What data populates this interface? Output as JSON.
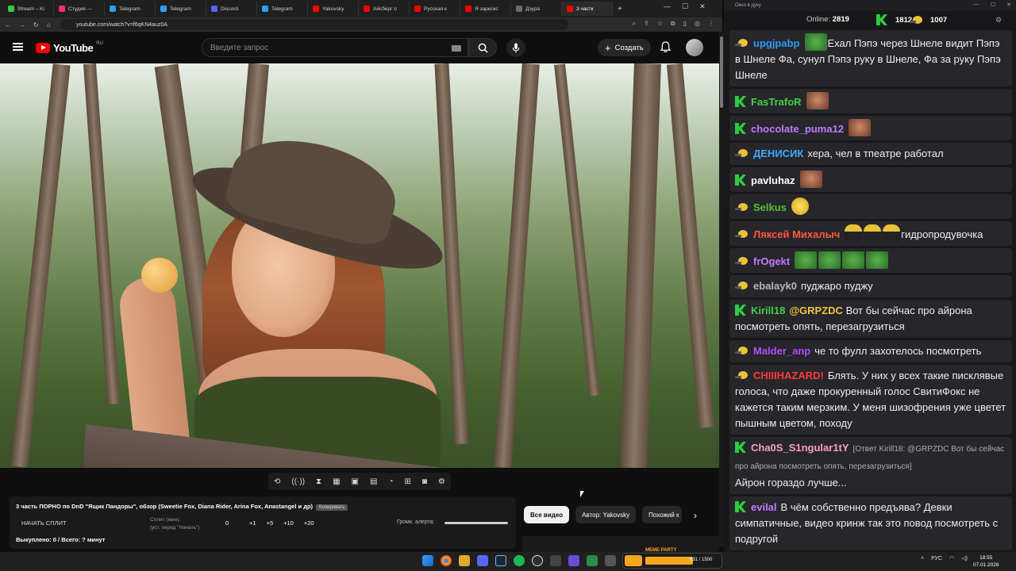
{
  "browser": {
    "tabs": [
      {
        "label": "Stream – Ki",
        "color": "#2ecc40"
      },
      {
        "label": "Студия —",
        "color": "#ff2e63"
      },
      {
        "label": "Telegram",
        "color": "#2aa3ef"
      },
      {
        "label": "Telegram",
        "color": "#2aa3ef"
      },
      {
        "label": "Discord",
        "color": "#5865f2"
      },
      {
        "label": "Telegram",
        "color": "#2aa3ef"
      },
      {
        "label": "Yakovsky",
        "color": "#ff0000"
      },
      {
        "label": "Айсберг о",
        "color": "#ff0000"
      },
      {
        "label": "Русская к",
        "color": "#ff0000"
      },
      {
        "label": "Я зарегис",
        "color": "#ff0000"
      },
      {
        "label": "Дзура",
        "color": "#6b6b6b"
      },
      {
        "label": "3 частк",
        "color": "#ff0000",
        "active": true
      }
    ],
    "new_tab": "+",
    "url": "youtube.com/watch?v=f6qKN4auz0A"
  },
  "youtube": {
    "logo_text": "YouTube",
    "region": "RU",
    "search_placeholder": "Введите запрос",
    "create_label": "Создать"
  },
  "split_panel": {
    "title": "3 часть ПОРНО по DnD \"Ящик Пандоры\", обзор (Sweetie Fox, Diana Rider, Arina Fox, Anastangel и др)",
    "copy_label": "Копировать",
    "start_label": "НАЧАТЬ СПЛИТ",
    "split_label": "Сплит (мин):",
    "split_hint": "(уст. перед \"Начать\")",
    "split_value": "0",
    "increments": [
      "+1",
      "+5",
      "+10",
      "+20"
    ],
    "volume_label": "Громк. алерта:",
    "bought": "Выкуплено: 0 / Всего: ? минут"
  },
  "chips": [
    {
      "label": "Все видео",
      "selected": true
    },
    {
      "label": "Автор: Yakovsky",
      "selected": false
    },
    {
      "label": "Похожий к",
      "selected": false
    }
  ],
  "chat": {
    "window_title": "Окно в дуку",
    "online_label": "Online:",
    "online_count": "2819",
    "k_count": "1812",
    "g_count": "1007",
    "messages": [
      {
        "badge": "g",
        "user": "upgjpabp",
        "color": "#2f9cf4",
        "emotes": [
          "pepe"
        ],
        "text": "Ехал Пэпэ через Шнеле видит Пэпэ в Шнеле Фа, сунул Пэпэ руку в Шнеле, Фа за руку Пэпэ Шнеле"
      },
      {
        "badge": "k",
        "user": "FasTrafoR",
        "color": "#45d04a",
        "emotes": [
          "face"
        ],
        "text": ""
      },
      {
        "badge": "k",
        "user": "chocolate_puma12",
        "color": "#c27bff",
        "emotes": [
          "face"
        ],
        "text": ""
      },
      {
        "badge": "g",
        "user": "ДЕНИСИК",
        "color": "#3fa9ff",
        "emotes": [],
        "text": "хера, чел в тпеатре работал"
      },
      {
        "badge": "k",
        "user": "pavluhaz",
        "color": "#ffffff",
        "emotes": [
          "face"
        ],
        "text": ""
      },
      {
        "badge": "g",
        "user": "Selkus",
        "color": "#52c234",
        "emotes": [
          "lol"
        ],
        "text": ""
      },
      {
        "badge": "g",
        "user": "Ляксей Михалыч",
        "color": "#ff5a3c",
        "emotes": [
          "dark",
          "dark",
          "dark"
        ],
        "text": "гидропродувочка"
      },
      {
        "badge": "g",
        "user": "frOgekt",
        "color": "#c27bff",
        "emotes": [
          "pepe",
          "pepe",
          "pepe",
          "pepe"
        ],
        "text": ""
      },
      {
        "badge": "g",
        "user": "ebalayk0",
        "color": "#b8b8b8",
        "emotes": [],
        "text": "пуджаро пуджу"
      },
      {
        "badge": "k",
        "user": "Kirill18",
        "color": "#45d04a",
        "mention": "@GRPZDC",
        "emotes": [],
        "text": "Вот бы сейчас про айрона посмотреть опять, перезагрузиться"
      },
      {
        "badge": "g",
        "user": "Malder_anp",
        "color": "#b44bff",
        "emotes": [],
        "text": "че то фулл захотелось посмотреть"
      },
      {
        "badge": "g",
        "user": "CHIIIHAZARD!",
        "color": "#ff3b3b",
        "emotes": [],
        "text": "Блять. У них у всех такие писклявые голоса, что даже прокуренный голос СвитиФокс не кажется таким мерзким. У меня шизофрения уже цветет пышным цветом, походу"
      },
      {
        "badge": "k",
        "user": "Cha0S_S1ngular1tY",
        "color": "#ff9ec0",
        "reply": "[Ответ Kirill18: @GRPZDC Вот бы сейчас про айрона посмотреть опять, перезагрузиться]",
        "emotes": [],
        "text": "Айрон гораздо лучше..."
      },
      {
        "badge": "k",
        "user": "evilal",
        "color": "#c27bff",
        "emotes": [],
        "text": "В чём собственно предъява? Девки симпатичные, видео кринж так это повод посмотреть с подругой"
      }
    ]
  },
  "meme_party": {
    "name": "MEME PARTY",
    "count": "631 / 1500"
  },
  "taskbar": {
    "lang": "РУС",
    "time": "18:55",
    "date": "07.01.2026"
  }
}
